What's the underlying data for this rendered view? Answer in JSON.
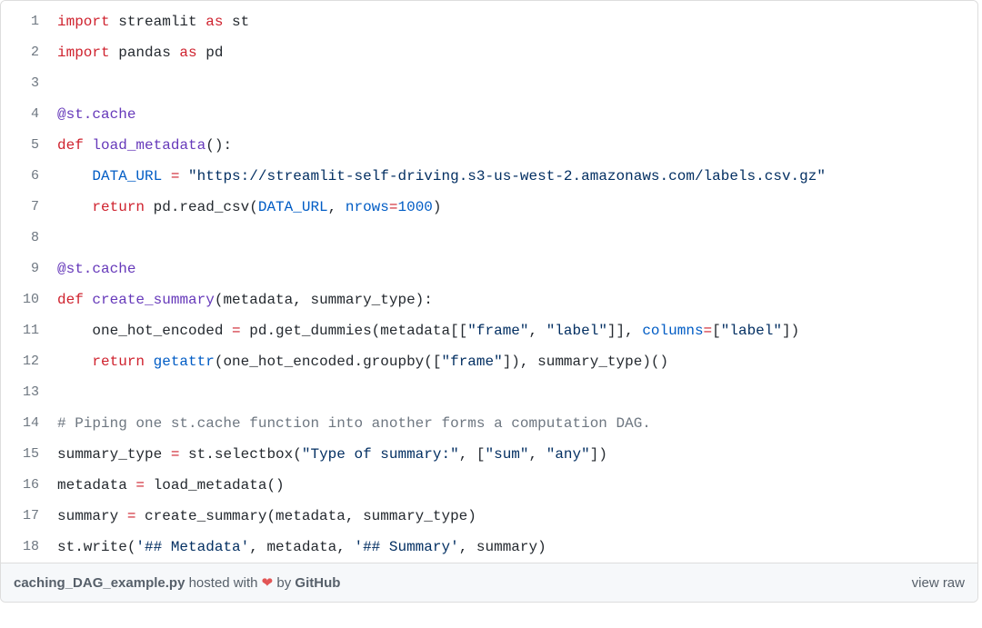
{
  "lines": [
    {
      "n": "1",
      "tokens": [
        [
          "kw",
          "import"
        ],
        [
          "nn",
          " streamlit "
        ],
        [
          "kw",
          "as"
        ],
        [
          "nn",
          " st"
        ]
      ]
    },
    {
      "n": "2",
      "tokens": [
        [
          "kw",
          "import"
        ],
        [
          "nn",
          " pandas "
        ],
        [
          "kw",
          "as"
        ],
        [
          "nn",
          " pd"
        ]
      ]
    },
    {
      "n": "3",
      "tokens": [
        [
          "nn",
          ""
        ]
      ]
    },
    {
      "n": "4",
      "tokens": [
        [
          "dec",
          "@st.cache"
        ]
      ]
    },
    {
      "n": "5",
      "tokens": [
        [
          "kw",
          "def"
        ],
        [
          "nn",
          " "
        ],
        [
          "fn",
          "load_metadata"
        ],
        [
          "nn",
          "():"
        ]
      ]
    },
    {
      "n": "6",
      "tokens": [
        [
          "nn",
          "    "
        ],
        [
          "bi",
          "DATA_URL"
        ],
        [
          "nn",
          " "
        ],
        [
          "op",
          "="
        ],
        [
          "nn",
          " "
        ],
        [
          "s",
          "\"https://streamlit-self-driving.s3-us-west-2.amazonaws.com/labels.csv.gz\""
        ]
      ]
    },
    {
      "n": "7",
      "tokens": [
        [
          "nn",
          "    "
        ],
        [
          "kw",
          "return"
        ],
        [
          "nn",
          " pd.read_csv("
        ],
        [
          "bi",
          "DATA_URL"
        ],
        [
          "nn",
          ", "
        ],
        [
          "bi",
          "nrows"
        ],
        [
          "op",
          "="
        ],
        [
          "num",
          "1000"
        ],
        [
          "nn",
          ")"
        ]
      ]
    },
    {
      "n": "8",
      "tokens": [
        [
          "nn",
          ""
        ]
      ]
    },
    {
      "n": "9",
      "tokens": [
        [
          "dec",
          "@st.cache"
        ]
      ]
    },
    {
      "n": "10",
      "tokens": [
        [
          "kw",
          "def"
        ],
        [
          "nn",
          " "
        ],
        [
          "fn",
          "create_summary"
        ],
        [
          "nn",
          "(metadata, summary_type):"
        ]
      ]
    },
    {
      "n": "11",
      "tokens": [
        [
          "nn",
          "    one_hot_encoded "
        ],
        [
          "op",
          "="
        ],
        [
          "nn",
          " pd.get_dummies(metadata[["
        ],
        [
          "s",
          "\"frame\""
        ],
        [
          "nn",
          ", "
        ],
        [
          "s",
          "\"label\""
        ],
        [
          "nn",
          "]], "
        ],
        [
          "bi",
          "columns"
        ],
        [
          "op",
          "="
        ],
        [
          "nn",
          "["
        ],
        [
          "s",
          "\"label\""
        ],
        [
          "nn",
          "])"
        ]
      ]
    },
    {
      "n": "12",
      "tokens": [
        [
          "nn",
          "    "
        ],
        [
          "kw",
          "return"
        ],
        [
          "nn",
          " "
        ],
        [
          "bi",
          "getattr"
        ],
        [
          "nn",
          "(one_hot_encoded.groupby(["
        ],
        [
          "s",
          "\"frame\""
        ],
        [
          "nn",
          "]), summary_type)()"
        ]
      ]
    },
    {
      "n": "13",
      "tokens": [
        [
          "nn",
          ""
        ]
      ]
    },
    {
      "n": "14",
      "tokens": [
        [
          "cm",
          "# Piping one st.cache function into another forms a computation DAG."
        ]
      ]
    },
    {
      "n": "15",
      "tokens": [
        [
          "nn",
          "summary_type "
        ],
        [
          "op",
          "="
        ],
        [
          "nn",
          " st.selectbox("
        ],
        [
          "s",
          "\"Type of summary:\""
        ],
        [
          "nn",
          ", ["
        ],
        [
          "s",
          "\"sum\""
        ],
        [
          "nn",
          ", "
        ],
        [
          "s",
          "\"any\""
        ],
        [
          "nn",
          "])"
        ]
      ]
    },
    {
      "n": "16",
      "tokens": [
        [
          "nn",
          "metadata "
        ],
        [
          "op",
          "="
        ],
        [
          "nn",
          " load_metadata()"
        ]
      ]
    },
    {
      "n": "17",
      "tokens": [
        [
          "nn",
          "summary "
        ],
        [
          "op",
          "="
        ],
        [
          "nn",
          " create_summary(metadata, summary_type)"
        ]
      ]
    },
    {
      "n": "18",
      "tokens": [
        [
          "nn",
          "st.write("
        ],
        [
          "s",
          "'## Metadata'"
        ],
        [
          "nn",
          ", metadata, "
        ],
        [
          "s",
          "'## Summary'"
        ],
        [
          "nn",
          ", summary)"
        ]
      ]
    }
  ],
  "meta": {
    "filename": "caching_DAG_example.py",
    "hosted_with": " hosted with ",
    "heart": "❤",
    "by": "  by ",
    "github": "GitHub",
    "view_raw": "view raw"
  }
}
